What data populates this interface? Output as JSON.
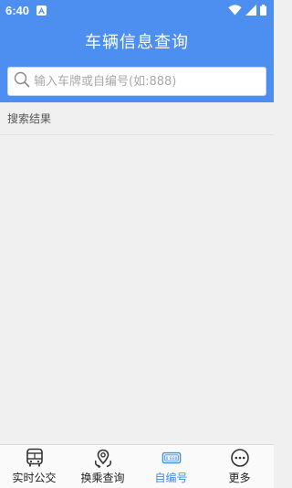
{
  "status_bar": {
    "time": "6:40"
  },
  "header": {
    "title": "车辆信息查询"
  },
  "search": {
    "placeholder": "输入车牌或自编号(如:888)",
    "value": ""
  },
  "results": {
    "label": "搜索结果"
  },
  "bottom_nav": {
    "items": [
      {
        "label": "实时公交",
        "icon": "bus-icon"
      },
      {
        "label": "换乘查询",
        "icon": "transfer-icon"
      },
      {
        "label": "自编号",
        "icon": "bus-number-icon",
        "badge": "8 888",
        "active": true
      },
      {
        "label": "更多",
        "icon": "more-icon"
      }
    ]
  },
  "colors": {
    "primary": "#4d8ff0",
    "active_tab": "#3a8ee6",
    "background": "#f0f0f0"
  }
}
